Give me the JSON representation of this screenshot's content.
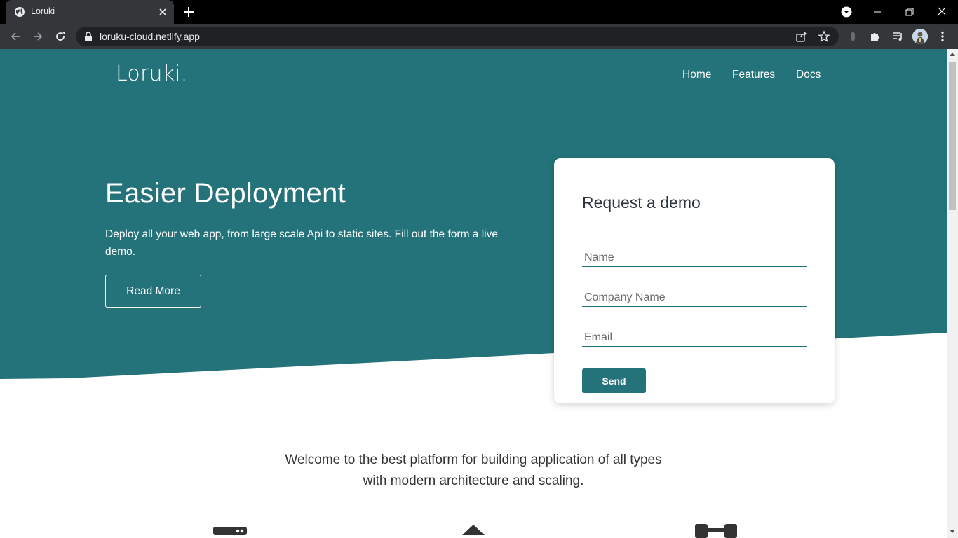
{
  "browser": {
    "tab": {
      "title": "Loruki"
    },
    "omnibox": {
      "url": "loruku-cloud.netlify.app"
    }
  },
  "page": {
    "brand": "Loruki.",
    "nav": [
      "Home",
      "Features",
      "Docs"
    ],
    "hero": {
      "title": "Easier Deployment",
      "text": "Deploy all your web app, from large scale Api to static sites. Fill out the form a live demo.",
      "button": "Read More"
    },
    "demo_form": {
      "title": "Request a demo",
      "name_placeholder": "Name",
      "company_placeholder": "Company Name",
      "email_placeholder": "Email",
      "send_label": "Send"
    },
    "welcome": "Welcome to the best platform for building application of all types with modern architecture and scaling."
  },
  "colors": {
    "primary": "#25737a",
    "chrome_dark": "#35363a",
    "omnibox": "#202124"
  },
  "icons": [
    "globe-icon",
    "close-icon",
    "plus-icon",
    "minimize-icon",
    "restore-icon",
    "back-icon",
    "forward-icon",
    "reload-icon",
    "lock-icon",
    "share-icon",
    "star-icon",
    "extensions-icon",
    "media-icon",
    "menu-icon",
    "server-icon",
    "triangle-icon",
    "connector-icon"
  ]
}
